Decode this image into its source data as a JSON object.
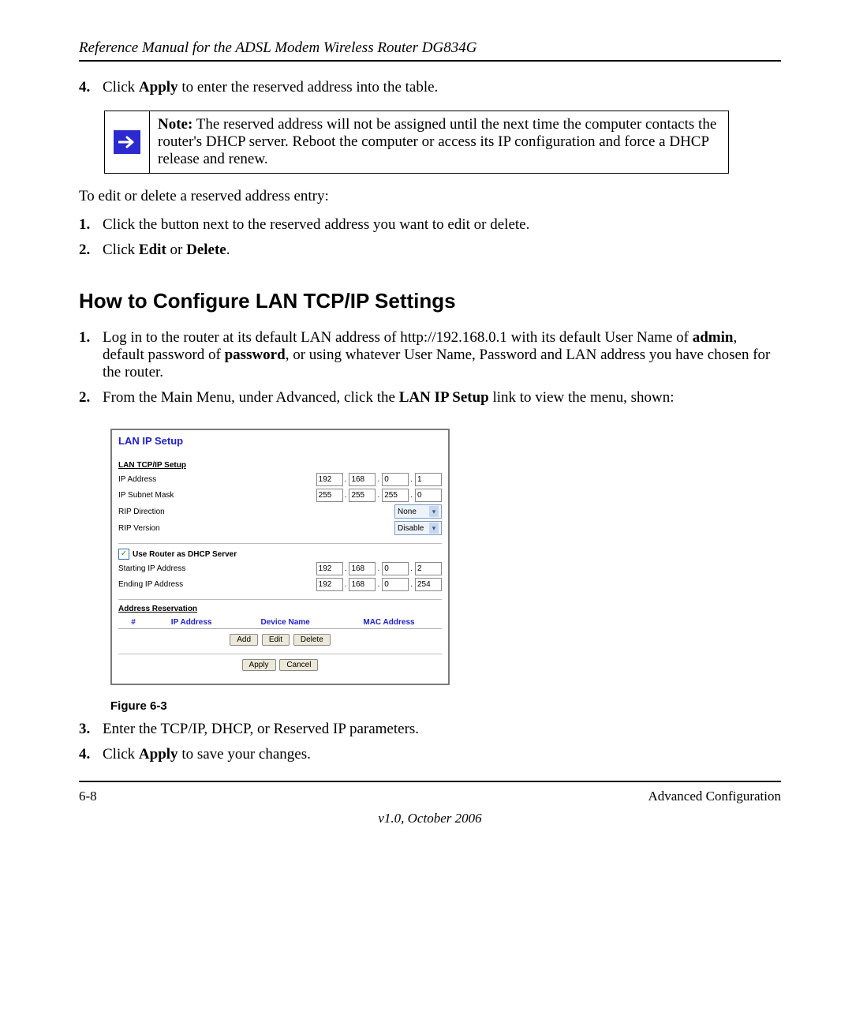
{
  "header": {
    "title": "Reference Manual for the ADSL Modem Wireless Router DG834G"
  },
  "step4": {
    "num": "4.",
    "prefix": "Click ",
    "bold": "Apply",
    "suffix": " to enter the reserved address into the table."
  },
  "note": {
    "label": "Note:",
    "text": " The reserved address will not be assigned until the next time the computer contacts the router's DHCP server. Reboot the computer or access its IP configuration and force a DHCP release and renew."
  },
  "edit_intro": "To edit or delete a reserved address entry:",
  "edit_steps": {
    "s1_num": "1.",
    "s1_text": "Click the button next to the reserved address you want to edit or delete.",
    "s2_num": "2.",
    "s2_prefix": "Click ",
    "s2_b1": "Edit",
    "s2_mid": " or ",
    "s2_b2": "Delete",
    "s2_suffix": "."
  },
  "section_title": "How to Configure LAN TCP/IP Settings",
  "cfg": {
    "s1_num": "1.",
    "s1_a": "Log in to the router at its default LAN address of http://192.168.0.1 with its default User Name of ",
    "s1_b1": "admin",
    "s1_b": ", default password of ",
    "s1_b2": "password",
    "s1_c": ", or using whatever User Name, Password and LAN address you have chosen for the router.",
    "s2_num": "2.",
    "s2_a": "From the Main Menu, under Advanced, click the ",
    "s2_b1": "LAN IP Setup",
    "s2_b": " link to view the menu, shown:",
    "s3_num": "3.",
    "s3_text": "Enter the TCP/IP, DHCP, or Reserved IP parameters.",
    "s4_num": "4.",
    "s4_prefix": "Click ",
    "s4_b1": "Apply",
    "s4_suffix": " to save your changes."
  },
  "lan": {
    "title": "LAN IP Setup",
    "sub_tcpip": "LAN TCP/IP Setup",
    "ip_label": "IP Address",
    "ip": [
      "192",
      "168",
      "0",
      "1"
    ],
    "mask_label": "IP Subnet Mask",
    "mask": [
      "255",
      "255",
      "255",
      "0"
    ],
    "ripdir_label": "RIP Direction",
    "ripdir_val": "None",
    "ripver_label": "RIP Version",
    "ripver_val": "Disable",
    "dhcp_chk": "Use Router as DHCP Server",
    "start_label": "Starting IP Address",
    "start": [
      "192",
      "168",
      "0",
      "2"
    ],
    "end_label": "Ending IP Address",
    "end": [
      "192",
      "168",
      "0",
      "254"
    ],
    "addr_res": "Address Reservation",
    "cols": {
      "hash": "#",
      "ip": "IP Address",
      "dev": "Device Name",
      "mac": "MAC Address"
    },
    "btns": {
      "add": "Add",
      "edit": "Edit",
      "del": "Delete",
      "apply": "Apply",
      "cancel": "Cancel"
    }
  },
  "fig_caption": "Figure 6-3",
  "footer": {
    "left": "6-8",
    "right": "Advanced Configuration",
    "version": "v1.0, October 2006"
  }
}
